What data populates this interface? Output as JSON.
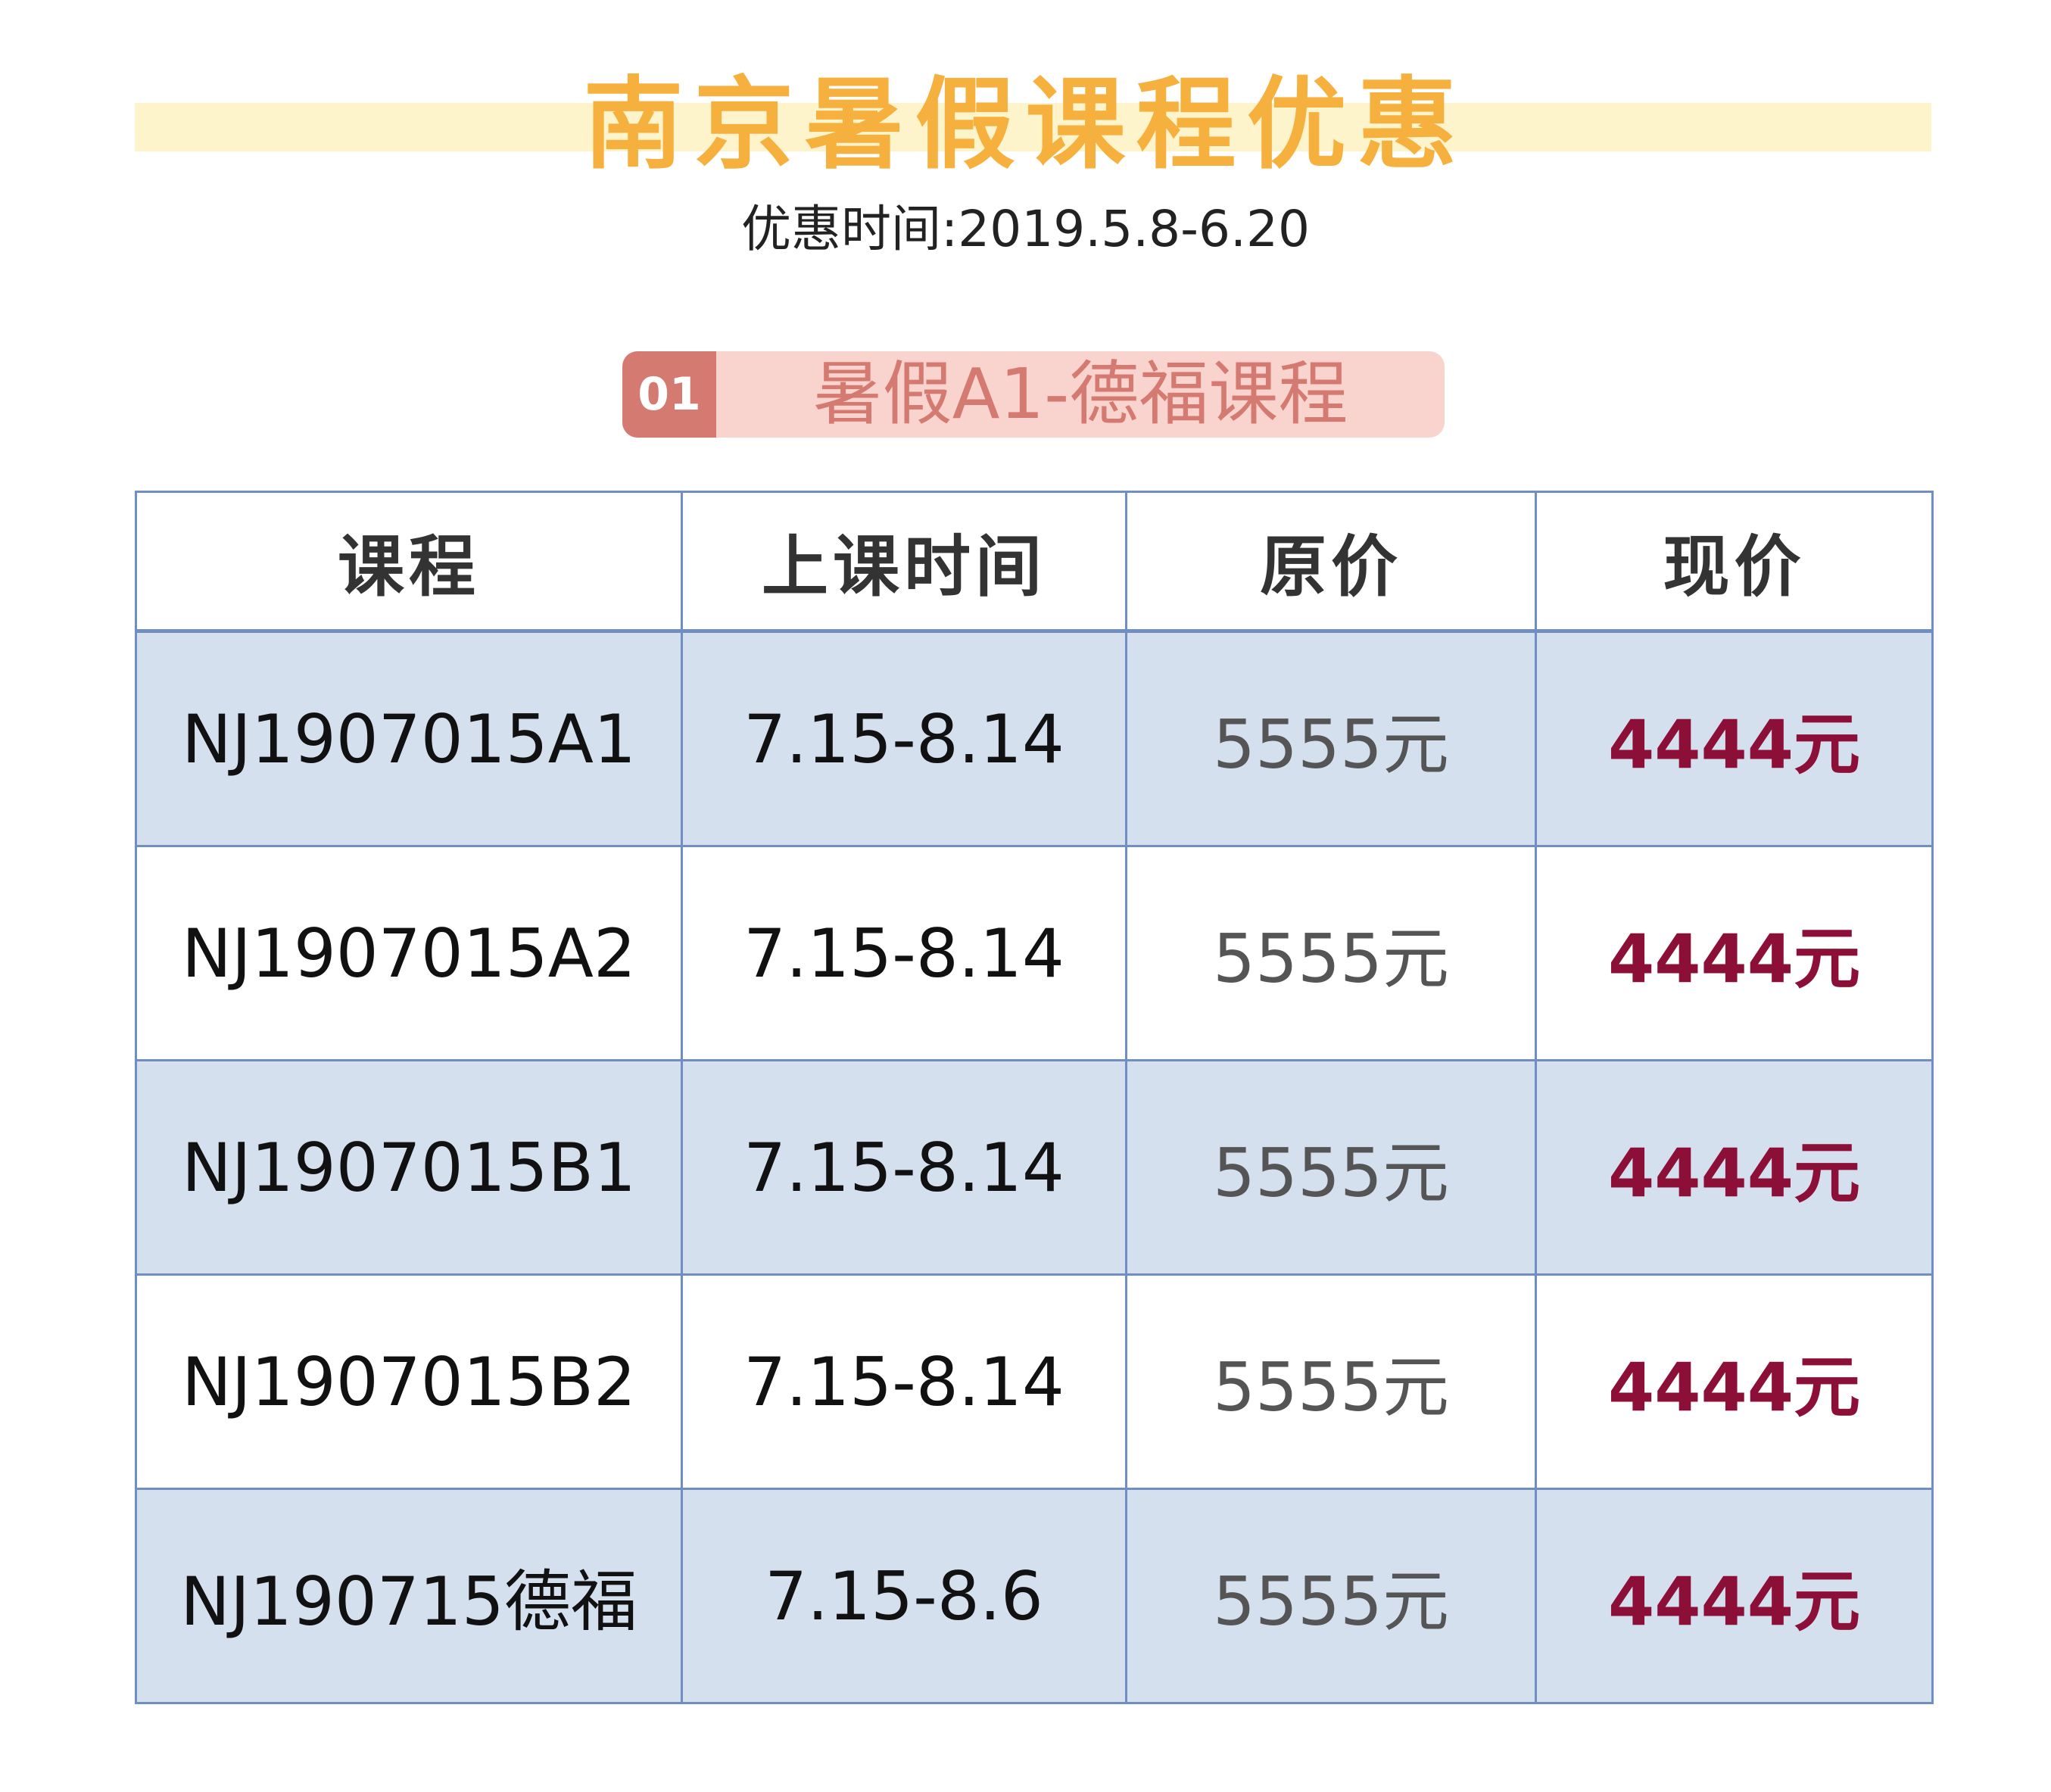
{
  "header": {
    "title": "南京暑假课程优惠",
    "subtitle": "优惠时间:2019.5.8-6.20"
  },
  "section": {
    "number": "01",
    "label": "暑假A1-德福课程"
  },
  "table": {
    "columns": [
      "课程",
      "上课时间",
      "原价",
      "现价"
    ],
    "rows": [
      {
        "course": "NJ1907015A1",
        "time": "7.15-8.14",
        "original_price": "5555元",
        "current_price": "4444元"
      },
      {
        "course": "NJ1907015A2",
        "time": "7.15-8.14",
        "original_price": "5555元",
        "current_price": "4444元"
      },
      {
        "course": "NJ1907015B1",
        "time": "7.15-8.14",
        "original_price": "5555元",
        "current_price": "4444元"
      },
      {
        "course": "NJ1907015B2",
        "time": "7.15-8.14",
        "original_price": "5555元",
        "current_price": "4444元"
      },
      {
        "course": "NJ190715德福",
        "time": "7.15-8.6",
        "original_price": "5555元",
        "current_price": "4444元"
      }
    ]
  },
  "colors": {
    "title": "#f6b03e",
    "title_band": "#fef4cc",
    "badge_bg": "#f9d4cf",
    "badge_accent": "#d57a70",
    "table_border": "#6f8fc4",
    "row_shade": "#d5e0ef",
    "current_price": "#8c0f37",
    "original_price": "#555555"
  }
}
